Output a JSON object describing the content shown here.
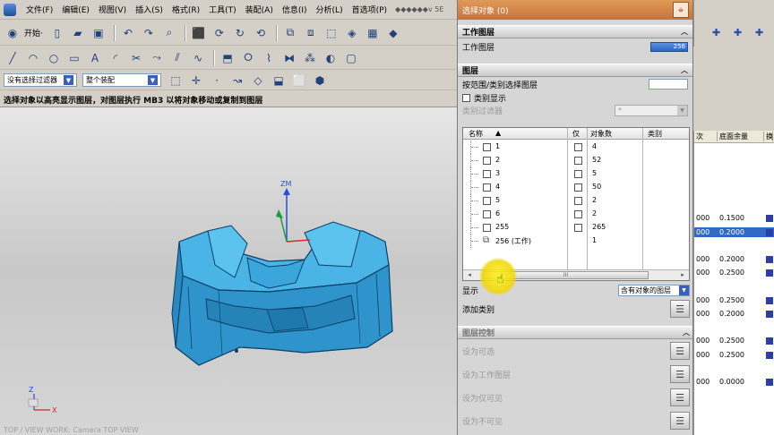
{
  "menu": {
    "items": [
      "文件(F)",
      "编辑(E)",
      "视图(V)",
      "插入(S)",
      "格式(R)",
      "工具(T)",
      "装配(A)",
      "信息(I)",
      "分析(L)",
      "首选项(P)"
    ],
    "brand": "◆◆◆◆◆◆v 5E"
  },
  "toolbar": {
    "start_label": "开始·",
    "selection_filter": "没有选择过滤器",
    "assembly_scope": "整个装配"
  },
  "status_text": "选择对象以高亮显示图层，对图层执行 MB3 以将对象移动或复制到图层",
  "viewport": {
    "axis_zm": "ZM",
    "axis_z": "Z",
    "axis_x": "X",
    "caption": "TOP / VIEW WORK: Camera TOP VIEW"
  },
  "dialog": {
    "select_objects_label": "选择对象 (0)",
    "work_layer_group": "工作图层",
    "work_layer_label": "工作图层",
    "work_layer_value": "256",
    "layers_group": "图层",
    "range_label": "按范围/类别选择图层",
    "category_display_label": "类别显示",
    "category_filter_label": "类别过滤器",
    "category_filter_value": "*",
    "table": {
      "col_name": "名称",
      "col_only": "仅",
      "col_count": "对象数",
      "col_category": "类别",
      "rows": [
        {
          "name": "1",
          "count": "4"
        },
        {
          "name": "2",
          "count": "52"
        },
        {
          "name": "3",
          "count": "5"
        },
        {
          "name": "4",
          "count": "50"
        },
        {
          "name": "5",
          "count": "2"
        },
        {
          "name": "6",
          "count": "2"
        },
        {
          "name": "255",
          "count": "265"
        },
        {
          "name": "256 (工作)",
          "count": "1"
        }
      ],
      "scroll_grip": "III"
    },
    "display_label": "显示",
    "display_value": "含有对象的图层",
    "add_category_label": "添加类别",
    "layer_control_group": "图层控制",
    "set_selectable": "设为可选",
    "set_work_layer": "设为工作图层",
    "set_visible_only": "设为仅可见",
    "set_invisible": "设为不可见"
  },
  "bg_table": {
    "headers": [
      "次",
      "底面余量",
      "换"
    ],
    "rows": [
      {
        "a": "000",
        "b": "0.1500",
        "sel": false
      },
      {
        "a": "000",
        "b": "0.2000",
        "sel": true
      },
      {
        "a": "000",
        "b": "0.2000",
        "sel": false
      },
      {
        "a": "000",
        "b": "0.2500",
        "sel": false
      },
      {
        "a": "000",
        "b": "0.2500",
        "sel": false
      },
      {
        "a": "000",
        "b": "0.2000",
        "sel": false
      },
      {
        "a": "000",
        "b": "0.2500",
        "sel": false
      },
      {
        "a": "000",
        "b": "0.2500",
        "sel": false
      },
      {
        "a": "000",
        "b": "0.0000",
        "sel": false
      }
    ]
  },
  "colors": {
    "model_blue": "#3aa0d8",
    "dialog_header_orange": "#c8723a",
    "selection_blue": "#316ac5",
    "highlight_yellow": "#f0d700"
  }
}
